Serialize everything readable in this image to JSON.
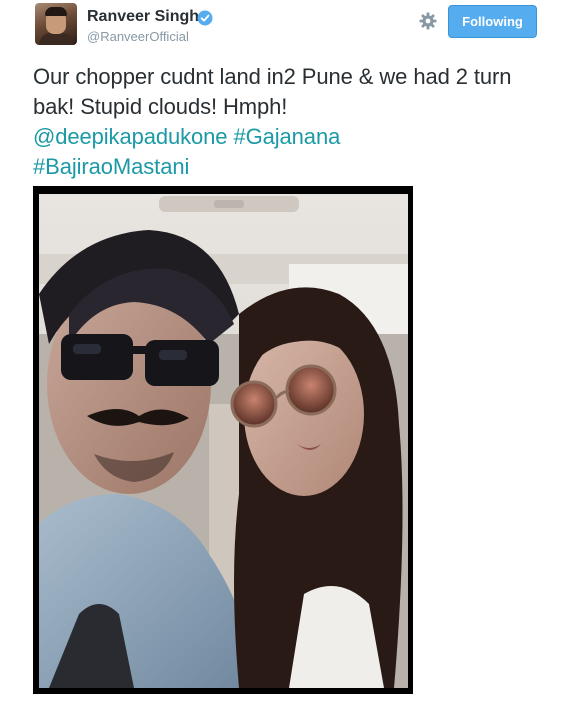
{
  "user": {
    "name": "Ranveer Singh",
    "handle": "@RanveerOfficial"
  },
  "actions": {
    "follow_label": "Following"
  },
  "tweet": {
    "text_line": "Our chopper cudnt land in2 Pune & we had 2 turn bak! Stupid clouds! Hmph!",
    "mention": "@deepikapadukone",
    "hashtag_1": "#Gajanana",
    "hashtag_2": "#BajiraoMastani"
  },
  "icons": {
    "verified": "verified-badge-icon",
    "settings": "gear-icon"
  },
  "colors": {
    "follow_button": "#55acee",
    "link": "#1b9aa6",
    "verified": "#1da1f2"
  }
}
